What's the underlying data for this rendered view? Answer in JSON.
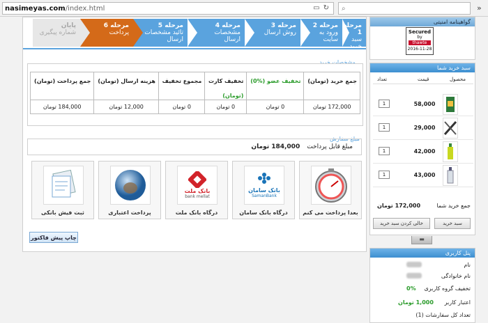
{
  "browser": {
    "host": "nasimeyas.com",
    "path": "/index.html"
  },
  "steps": [
    {
      "num": "مرحله 1",
      "label": "سبد خرید",
      "state": "blue"
    },
    {
      "num": "مرحله 2",
      "label": "ورود به سایت",
      "state": "blue"
    },
    {
      "num": "مرحله 3",
      "label": "روش ارسال",
      "state": "blue"
    },
    {
      "num": "مرحله 4",
      "label": "مشخصات ارسال",
      "state": "blue"
    },
    {
      "num": "مرحله 5",
      "label": "تائید مشخصات ارسال",
      "state": "blue"
    },
    {
      "num": "مرحله 6",
      "label": "پرداخت",
      "state": "orange"
    },
    {
      "num": "پایان",
      "label": "شماره پیگیری",
      "state": "gray"
    }
  ],
  "invoice": {
    "section_title": "مشخصات خرید",
    "headers": {
      "total": "جمع خرید (تومان)",
      "member_discount": "تخفیف عضو (%0)",
      "card_discount": "تخفیف کارت",
      "card_discount_sub": "(تومان)",
      "discount_sum": "مجموع تخفیف",
      "shipping": "هزینه ارسال (تومان)",
      "payable": "جمع پرداخت (تومان)"
    },
    "row": {
      "total": "172,000 تومان",
      "member_discount": "0 تومان",
      "card_discount": "0 تومان",
      "discount_sum": "0 تومان",
      "shipping": "12,000 تومان",
      "payable": "184,000 تومان"
    }
  },
  "order_amount": {
    "section_title": "مبلغ سفارش",
    "label": "مبلغ قابل پرداخت",
    "value": "184,000 تومان"
  },
  "gateways": [
    {
      "label": "بعدا پرداخت می کنم",
      "icon": "stopwatch-icon"
    },
    {
      "label": "درگاه بانک سامان",
      "icon": "saman-bank-logo",
      "logo_text": "بانک سامان",
      "logo_sub": "SamanBank"
    },
    {
      "label": "درگاه بانک ملت",
      "icon": "mellat-bank-logo",
      "logo_text": "بانک ملت",
      "logo_sub": "bank mellat"
    },
    {
      "label": "پرداخت اعتباری",
      "icon": "credit-globe-icon"
    },
    {
      "label": "ثبت فیش بانکی",
      "icon": "bank-receipt-icon"
    }
  ],
  "print_button": "چاپ پیش فاکتور",
  "sidebar": {
    "seal": {
      "title": "گواهینامه امنیتی",
      "line1": "Secured",
      "line2": "by",
      "brand": "thawte",
      "date": "2016-11-28"
    },
    "cart": {
      "title": "سبد خرید شما",
      "col_product": "محصول",
      "col_price": "قیمت",
      "col_qty": "تعداد",
      "items": [
        {
          "price": "58,000",
          "qty": "1"
        },
        {
          "price": "29,000",
          "qty": "1"
        },
        {
          "price": "42,000",
          "qty": "1"
        },
        {
          "price": "43,000",
          "qty": "1"
        }
      ],
      "total_label": "جمع خرید شما",
      "total_value": "172,000 تومان",
      "cart_button": "سبد خرید",
      "empty_button": "خالی کردن سبد خرید"
    },
    "user_panel": {
      "title": "پنل کاربری",
      "name_label": "نام",
      "family_label": "نام خانوادگی",
      "group_discount_label": "تخفیف گروه کاربری",
      "group_discount_value": "0%",
      "credit_label": "اعتبار کاربر",
      "credit_value": "1,000 تومان",
      "orders_label": "تعداد کل سفارشات (1)"
    }
  }
}
